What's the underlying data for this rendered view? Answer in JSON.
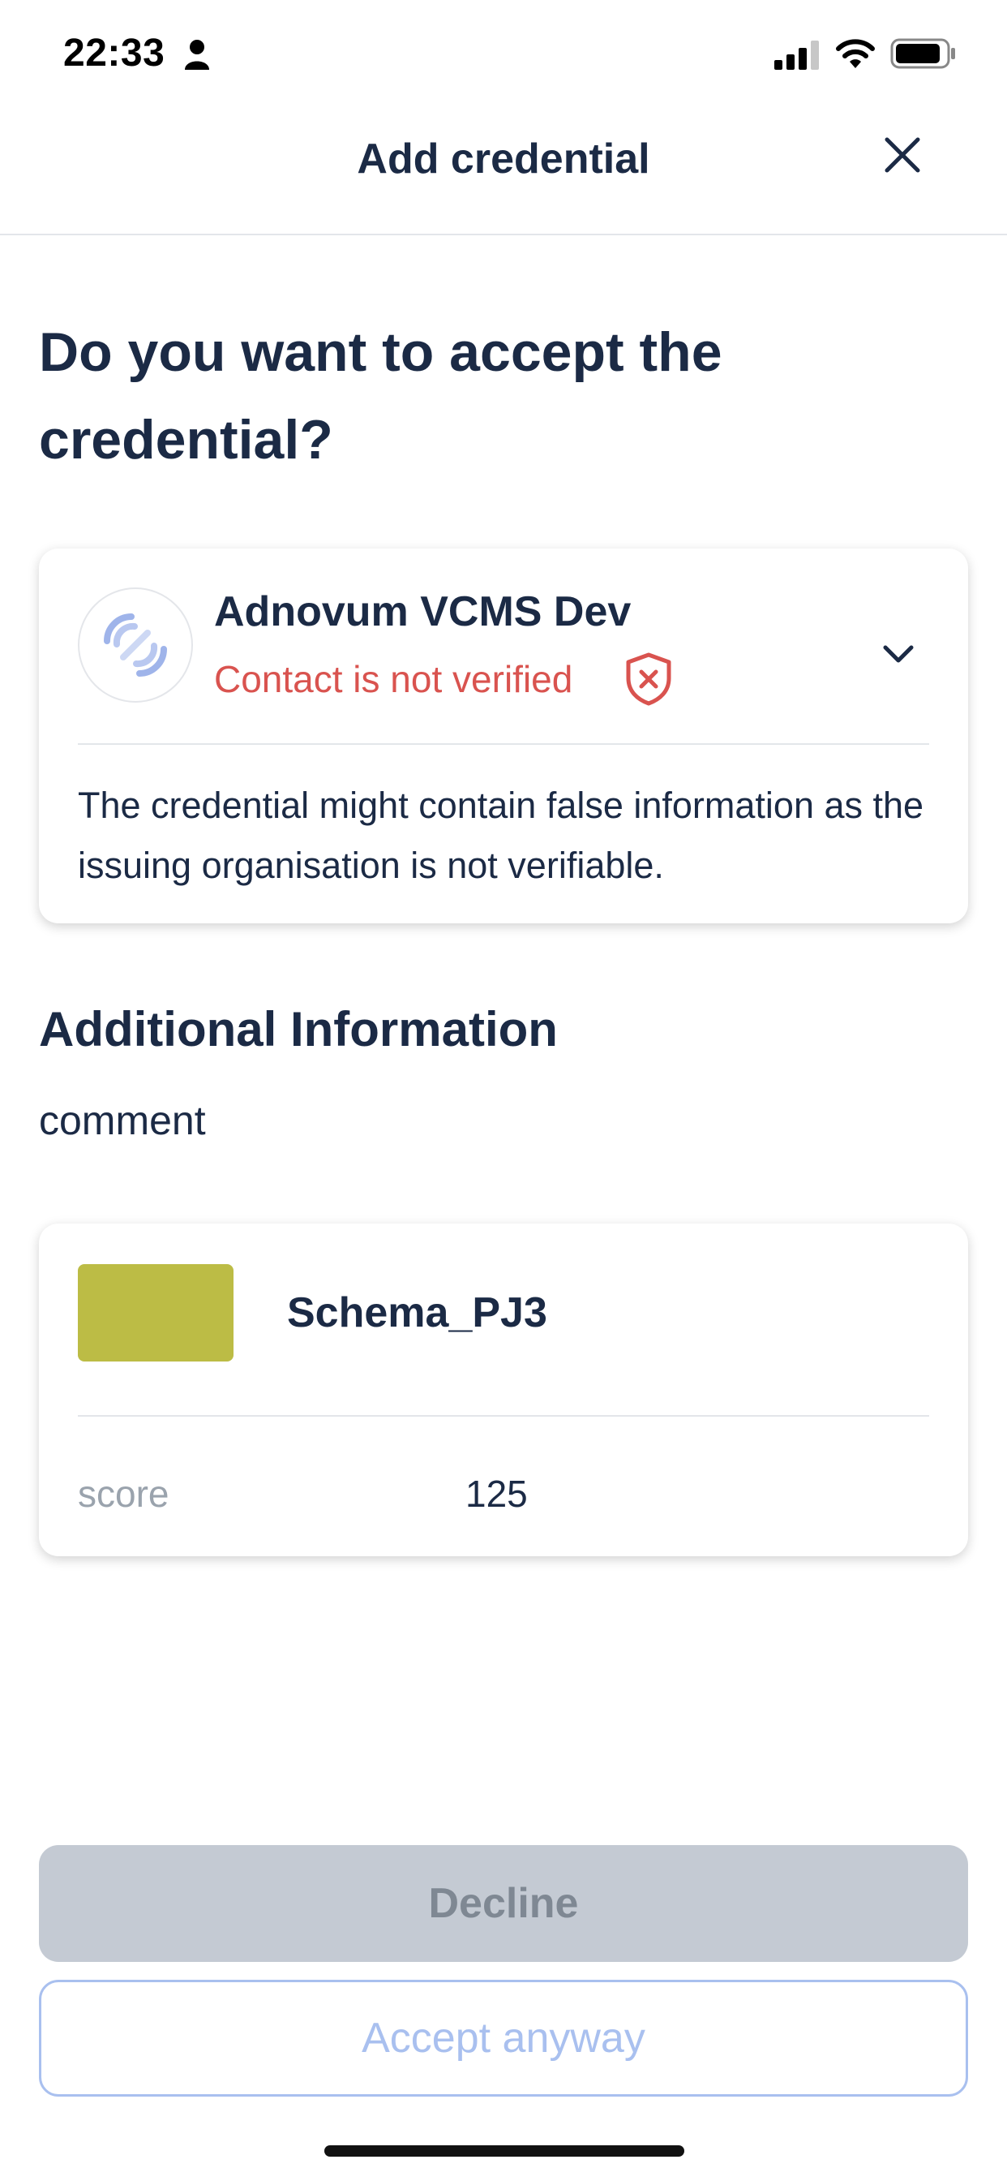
{
  "status_bar": {
    "time": "22:33",
    "icons": [
      "person-icon",
      "signal-icon",
      "wifi-icon",
      "battery-icon"
    ]
  },
  "header": {
    "title": "Add credential",
    "close_icon": "close-icon"
  },
  "main": {
    "question": "Do you want to accept the credential?"
  },
  "issuer": {
    "name": "Adnovum VCMS Dev",
    "status": "Contact is not verified",
    "status_icon": "shield-x-icon",
    "warning": "The credential might contain false information as the issuing organisation is not verifiable.",
    "colors": {
      "status": "#d9534f"
    }
  },
  "additional_info": {
    "title": "Additional Information",
    "comment": "comment"
  },
  "credential": {
    "name": "Schema_PJ3",
    "thumb_color": "#bcbc45",
    "attributes": [
      {
        "label": "score",
        "value": "125"
      }
    ]
  },
  "actions": {
    "decline_label": "Decline",
    "accept_label": "Accept anyway"
  }
}
